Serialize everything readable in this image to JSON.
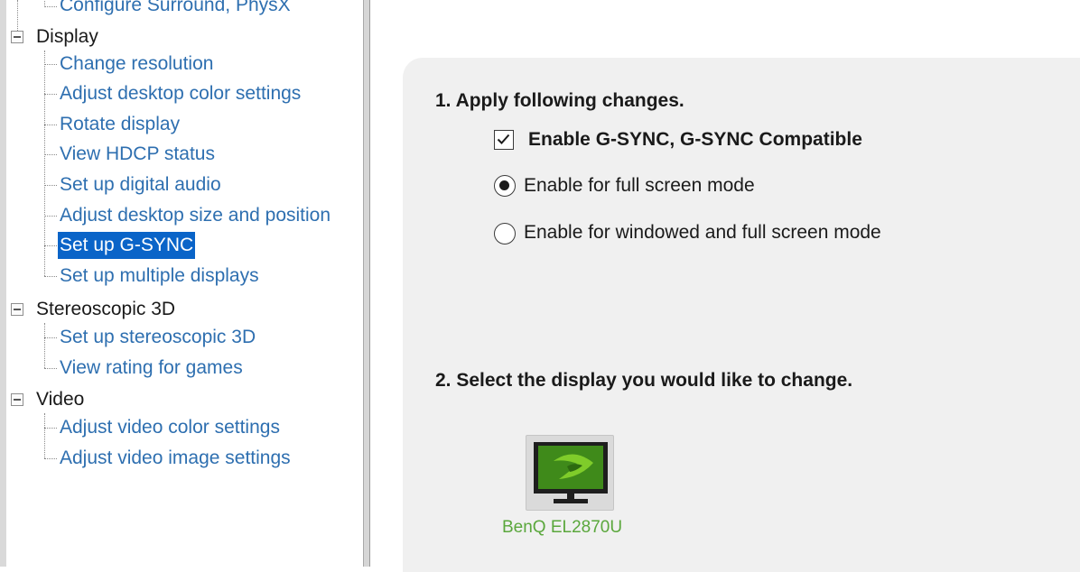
{
  "tree": {
    "top_item": "Configure Surround, PhysX",
    "categories": [
      {
        "label": "Display",
        "items": [
          "Change resolution",
          "Adjust desktop color settings",
          "Rotate display",
          "View HDCP status",
          "Set up digital audio",
          "Adjust desktop size and position",
          "Set up G-SYNC",
          "Set up multiple displays"
        ],
        "selected": "Set up G-SYNC"
      },
      {
        "label": "Stereoscopic 3D",
        "items": [
          "Set up stereoscopic 3D",
          "View rating for games"
        ]
      },
      {
        "label": "Video",
        "items": [
          "Adjust video color settings",
          "Adjust video image settings"
        ]
      }
    ]
  },
  "main": {
    "step1": {
      "heading": "1. Apply following changes.",
      "checkbox_label": "Enable G-SYNC, G-SYNC Compatible",
      "checkbox_checked": true,
      "radio_fullscreen": "Enable for full screen mode",
      "radio_windowed": "Enable for windowed and full screen mode",
      "selected_radio": "fullscreen"
    },
    "step2": {
      "heading": "2. Select the display you would like to change.",
      "display_name": "BenQ EL2870U"
    }
  },
  "colors": {
    "link": "#2e6fb0",
    "selection": "#0a64c8",
    "nvidia_green": "#76b900",
    "display_label": "#5aa73c"
  }
}
